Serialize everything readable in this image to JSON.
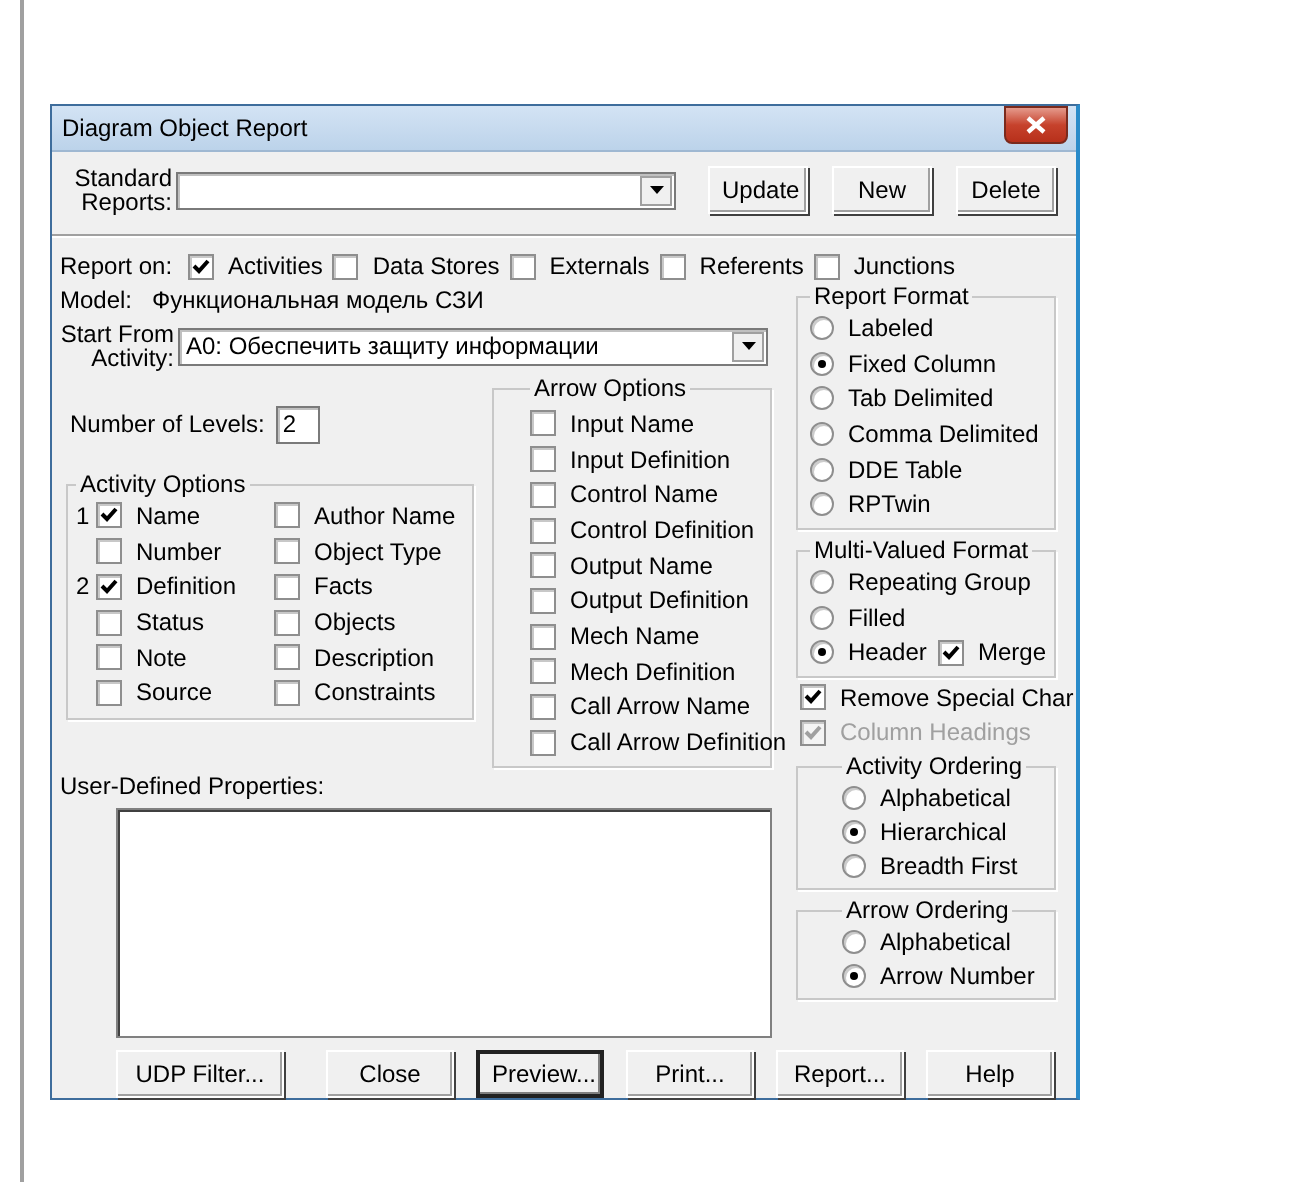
{
  "window": {
    "title": "Diagram Object Report"
  },
  "standard_reports": {
    "label": "Standard Reports:"
  },
  "top_buttons": [
    {
      "label": "Update"
    },
    {
      "label": "New"
    },
    {
      "label": "Delete"
    }
  ],
  "report_on": {
    "label": "Report on:",
    "options": [
      {
        "label": "Activities",
        "checked": true
      },
      {
        "label": "Data Stores",
        "checked": false
      },
      {
        "label": "Externals",
        "checked": false
      },
      {
        "label": "Referents",
        "checked": false
      },
      {
        "label": "Junctions",
        "checked": false
      }
    ]
  },
  "model": {
    "label": "Model:",
    "value": "Функциональная модель СЗИ"
  },
  "start_from": {
    "label": "Start From Activity:",
    "value": "A0:  Обеспечить защиту информации"
  },
  "levels": {
    "label": "Number of Levels:",
    "value": "2"
  },
  "activity_options": {
    "title": "Activity Options",
    "columns": [
      [
        {
          "order": "1",
          "label": "Name",
          "checked": true
        },
        {
          "label": "Number",
          "checked": false
        },
        {
          "order": "2",
          "label": "Definition",
          "checked": true
        },
        {
          "label": "Status",
          "checked": false
        },
        {
          "label": "Note",
          "checked": false
        },
        {
          "label": "Source",
          "checked": false
        }
      ],
      [
        {
          "label": "Author Name",
          "checked": false
        },
        {
          "label": "Object Type",
          "checked": false
        },
        {
          "label": "Facts",
          "checked": false
        },
        {
          "label": "Objects",
          "checked": false
        },
        {
          "label": "Description",
          "checked": false
        },
        {
          "label": "Constraints",
          "checked": false
        }
      ]
    ]
  },
  "arrow_options": {
    "title": "Arrow Options",
    "items": [
      {
        "label": "Input Name",
        "checked": false
      },
      {
        "label": "Input Definition",
        "checked": false
      },
      {
        "label": "Control Name",
        "checked": false
      },
      {
        "label": "Control Definition",
        "checked": false
      },
      {
        "label": "Output Name",
        "checked": false
      },
      {
        "label": "Output Definition",
        "checked": false
      },
      {
        "label": "Mech Name",
        "checked": false
      },
      {
        "label": "Mech Definition",
        "checked": false
      },
      {
        "label": "Call Arrow Name",
        "checked": false
      },
      {
        "label": "Call Arrow Definition",
        "checked": false
      }
    ]
  },
  "user_defined_properties": {
    "label": "User-Defined Properties:"
  },
  "report_format": {
    "title": "Report Format",
    "options": [
      {
        "label": "Labeled",
        "selected": false
      },
      {
        "label": "Fixed Column",
        "selected": true
      },
      {
        "label": "Tab Delimited",
        "selected": false
      },
      {
        "label": "Comma Delimited",
        "selected": false
      },
      {
        "label": "DDE Table",
        "selected": false
      },
      {
        "label": "RPTwin",
        "selected": false
      }
    ]
  },
  "multi_valued_format": {
    "title": "Multi-Valued Format",
    "options": [
      {
        "label": "Repeating Group",
        "selected": false
      },
      {
        "label": "Filled",
        "selected": false
      },
      {
        "label": "Header",
        "selected": true,
        "extra": {
          "label": "Merge",
          "checked": true
        }
      }
    ]
  },
  "remove_special_char": {
    "label": "Remove Special Char",
    "checked": true,
    "disabled": false
  },
  "column_headings": {
    "label": "Column Headings",
    "checked": true,
    "disabled": true
  },
  "activity_ordering": {
    "title": "Activity Ordering",
    "options": [
      {
        "label": "Alphabetical",
        "selected": false
      },
      {
        "label": "Hierarchical",
        "selected": true
      },
      {
        "label": "Breadth First",
        "selected": false
      }
    ]
  },
  "arrow_ordering": {
    "title": "Arrow Ordering",
    "options": [
      {
        "label": "Alphabetical",
        "selected": false
      },
      {
        "label": "Arrow Number",
        "selected": true
      }
    ]
  },
  "bottom_buttons": [
    {
      "label": "UDP Filter...",
      "default": false
    },
    {
      "label": "Close",
      "default": false
    },
    {
      "label": "Preview...",
      "default": true
    },
    {
      "label": "Print...",
      "default": false
    },
    {
      "label": "Report...",
      "default": false
    },
    {
      "label": "Help",
      "default": false
    }
  ]
}
